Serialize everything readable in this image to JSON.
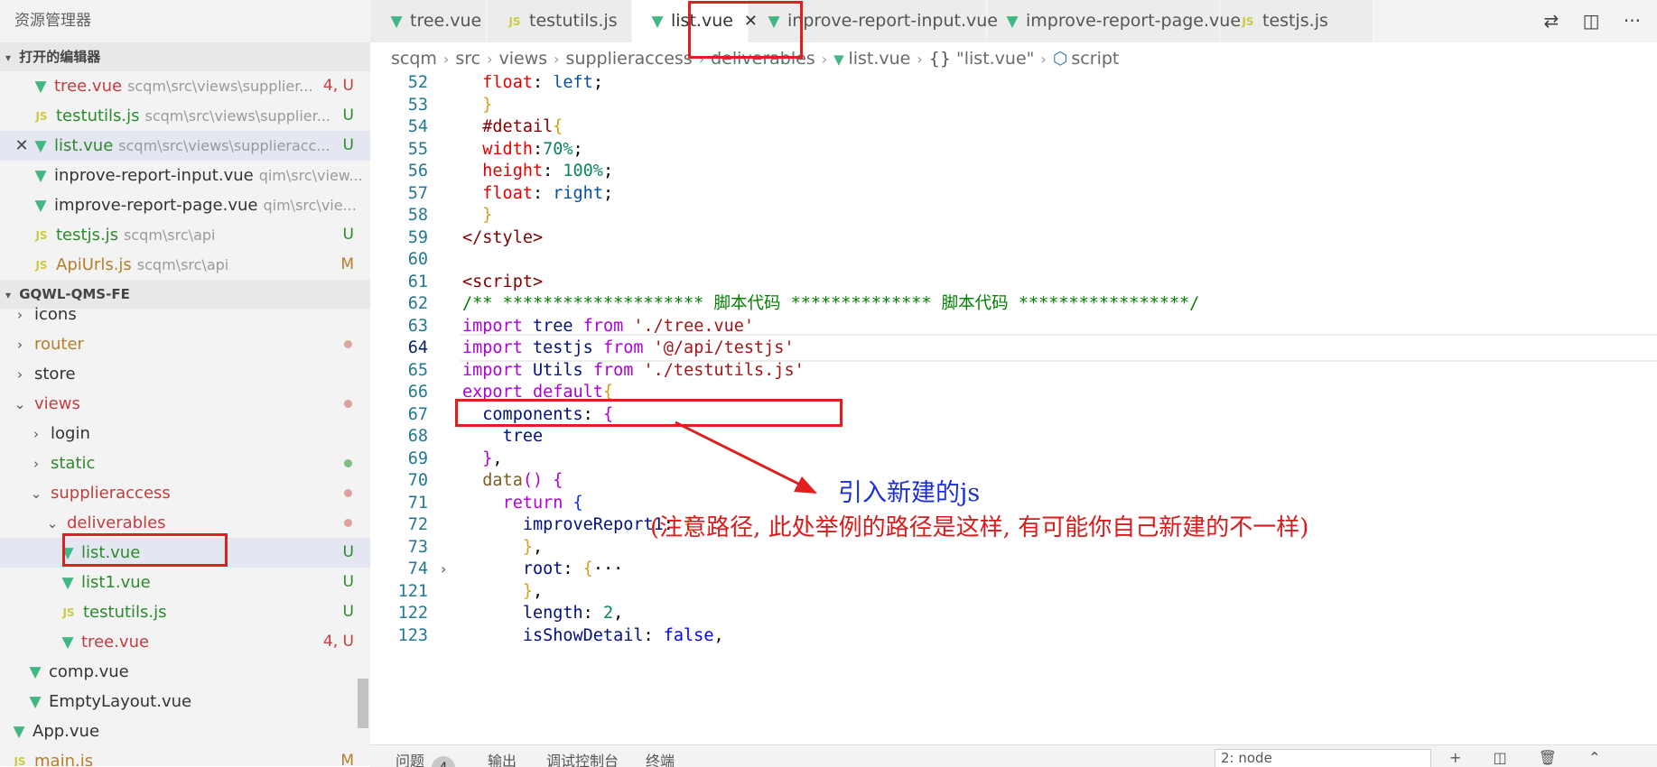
{
  "sidebar": {
    "title": "资源管理器",
    "open_editors": {
      "header": "打开的编辑器",
      "items": [
        {
          "name": "tree.vue",
          "path": "scqm\\src\\views\\supplier...",
          "status": "4, U",
          "type": "vue",
          "color": "err"
        },
        {
          "name": "testutils.js",
          "path": "scqm\\src\\views\\supplier...",
          "status": "U",
          "type": "js",
          "color": "unt"
        },
        {
          "name": "list.vue",
          "path": "scqm\\src\\views\\supplieracc...",
          "status": "U",
          "type": "vue",
          "color": "unt",
          "active": true
        },
        {
          "name": "inprove-report-input.vue",
          "path": "qim\\src\\view...",
          "status": "",
          "type": "vue",
          "color": "dflt"
        },
        {
          "name": "improve-report-page.vue",
          "path": "qim\\src\\vie...",
          "status": "",
          "type": "vue",
          "color": "dflt"
        },
        {
          "name": "testjs.js",
          "path": "scqm\\src\\api",
          "status": "U",
          "type": "js",
          "color": "unt"
        },
        {
          "name": "ApiUrls.js",
          "path": "scqm\\src\\api",
          "status": "M",
          "type": "js",
          "color": "mod"
        }
      ]
    },
    "project": {
      "header": "GQWL-QMS-FE",
      "tree": [
        {
          "label": "icons",
          "indent": 1,
          "kind": "folder-closed",
          "color": "dflt",
          "dot": ""
        },
        {
          "label": "router",
          "indent": 1,
          "kind": "folder-closed",
          "color": "mod",
          "dot": "#d9a7a0"
        },
        {
          "label": "store",
          "indent": 1,
          "kind": "folder-closed",
          "color": "dflt",
          "dot": ""
        },
        {
          "label": "views",
          "indent": 1,
          "kind": "folder-open",
          "color": "err",
          "dot": "#e0a0a0"
        },
        {
          "label": "login",
          "indent": 2,
          "kind": "folder-closed",
          "color": "dflt",
          "dot": ""
        },
        {
          "label": "static",
          "indent": 2,
          "kind": "folder-closed",
          "color": "unt",
          "dot": "#7fbf7f"
        },
        {
          "label": "supplieraccess",
          "indent": 2,
          "kind": "folder-open",
          "color": "err",
          "dot": "#e0a0a0"
        },
        {
          "label": "deliverables",
          "indent": 3,
          "kind": "folder-open",
          "color": "err",
          "dot": "#e0a0a0"
        },
        {
          "label": "list.vue",
          "indent": 4,
          "kind": "vue",
          "color": "unt",
          "status": "U",
          "selected": true
        },
        {
          "label": "list1.vue",
          "indent": 4,
          "kind": "vue",
          "color": "unt",
          "status": "U"
        },
        {
          "label": "testutils.js",
          "indent": 4,
          "kind": "js",
          "color": "unt",
          "status": "U"
        },
        {
          "label": "tree.vue",
          "indent": 4,
          "kind": "vue",
          "color": "err",
          "status": "4, U"
        },
        {
          "label": "comp.vue",
          "indent": 2,
          "kind": "vue",
          "color": "dflt",
          "status": ""
        },
        {
          "label": "EmptyLayout.vue",
          "indent": 2,
          "kind": "vue",
          "color": "dflt",
          "status": ""
        },
        {
          "label": "App.vue",
          "indent": 1,
          "kind": "vue",
          "color": "dflt",
          "status": ""
        },
        {
          "label": "main.js",
          "indent": 1,
          "kind": "js",
          "color": "mod",
          "status": "M"
        }
      ]
    }
  },
  "tabs": [
    {
      "label": "tree.vue",
      "type": "vue",
      "color": "err"
    },
    {
      "label": "testutils.js",
      "type": "js",
      "color": "unt"
    },
    {
      "label": "list.vue",
      "type": "vue",
      "color": "unt",
      "active": true
    },
    {
      "label": "inprove-report-input.vue",
      "type": "vue",
      "color": "dflt"
    },
    {
      "label": "improve-report-page.vue",
      "type": "vue",
      "color": "dflt"
    },
    {
      "label": "testjs.js",
      "type": "js",
      "color": "unt"
    }
  ],
  "breadcrumb": {
    "segments": [
      "scqm",
      "src",
      "views",
      "supplieraccess",
      "deliverables"
    ],
    "file": "list.vue",
    "object": "\"list.vue\"",
    "symbol": "script"
  },
  "editor": {
    "current_line": "64",
    "lines": [
      {
        "n": "52",
        "indent": 1,
        "tokens": [
          [
            "float",
            "prop"
          ],
          [
            ": ",
            "pl"
          ],
          [
            "left",
            "val"
          ],
          [
            ";",
            "pl"
          ]
        ]
      },
      {
        "n": "53",
        "indent": 0,
        "tokens": [
          [
            "  }",
            "br"
          ]
        ]
      },
      {
        "n": "54",
        "indent": 0,
        "tokens": [
          [
            "  #detail",
            "sel"
          ],
          [
            "{",
            "br"
          ]
        ]
      },
      {
        "n": "55",
        "indent": 1,
        "tokens": [
          [
            "width",
            "prop"
          ],
          [
            ":",
            "pl"
          ],
          [
            "70%",
            "num"
          ],
          [
            ";",
            "pl"
          ]
        ]
      },
      {
        "n": "56",
        "indent": 1,
        "tokens": [
          [
            "height",
            "prop"
          ],
          [
            ": ",
            "pl"
          ],
          [
            "100%",
            "num"
          ],
          [
            ";",
            "pl"
          ]
        ]
      },
      {
        "n": "57",
        "indent": 1,
        "tokens": [
          [
            "float",
            "prop"
          ],
          [
            ": ",
            "pl"
          ],
          [
            "right",
            "val"
          ],
          [
            ";",
            "pl"
          ]
        ]
      },
      {
        "n": "58",
        "indent": 0,
        "tokens": [
          [
            "  }",
            "br"
          ]
        ]
      },
      {
        "n": "59",
        "indent": 0,
        "tokens": [
          [
            "</style>",
            "tag"
          ]
        ]
      },
      {
        "n": "60",
        "indent": 0,
        "tokens": []
      },
      {
        "n": "61",
        "indent": 0,
        "tokens": [
          [
            "<script>",
            "tag"
          ]
        ]
      },
      {
        "n": "62",
        "indent": 0,
        "tokens": [
          [
            "/** ******************** 脚本代码 ************** 脚本代码 *****************/",
            "cmt"
          ]
        ]
      },
      {
        "n": "63",
        "indent": 0,
        "tokens": [
          [
            "import",
            "kw"
          ],
          [
            " ",
            "pl"
          ],
          [
            "tree",
            "id"
          ],
          [
            " ",
            "pl"
          ],
          [
            "from",
            "kw"
          ],
          [
            " ",
            "pl"
          ],
          [
            "'./tree.vue'",
            "str"
          ]
        ]
      },
      {
        "n": "64",
        "indent": 0,
        "tokens": [
          [
            "import",
            "kw"
          ],
          [
            " ",
            "pl"
          ],
          [
            "testjs",
            "id"
          ],
          [
            " ",
            "pl"
          ],
          [
            "from",
            "kw"
          ],
          [
            " ",
            "pl"
          ],
          [
            "'@/api/testjs'",
            "str"
          ]
        ]
      },
      {
        "n": "65",
        "indent": 0,
        "tokens": [
          [
            "import",
            "kw"
          ],
          [
            " ",
            "pl"
          ],
          [
            "Utils",
            "id"
          ],
          [
            " ",
            "pl"
          ],
          [
            "from",
            "kw"
          ],
          [
            " ",
            "pl"
          ],
          [
            "'./testutils.js'",
            "str"
          ]
        ]
      },
      {
        "n": "66",
        "indent": 0,
        "tokens": [
          [
            "export",
            "kw"
          ],
          [
            " ",
            "pl"
          ],
          [
            "default",
            "kw"
          ],
          [
            "{",
            "br"
          ]
        ]
      },
      {
        "n": "67",
        "indent": 1,
        "tokens": [
          [
            "components",
            "id"
          ],
          [
            ": ",
            "pl"
          ],
          [
            "{",
            "br2"
          ]
        ]
      },
      {
        "n": "68",
        "indent": 2,
        "tokens": [
          [
            "tree",
            "id"
          ]
        ]
      },
      {
        "n": "69",
        "indent": 1,
        "tokens": [
          [
            "}",
            "br2"
          ],
          [
            ",",
            "pl"
          ]
        ]
      },
      {
        "n": "70",
        "indent": 1,
        "tokens": [
          [
            "data",
            "fn"
          ],
          [
            "()",
            "br2"
          ],
          [
            " ",
            "pl"
          ],
          [
            "{",
            "br2"
          ]
        ]
      },
      {
        "n": "71",
        "indent": 2,
        "tokens": [
          [
            "return",
            "kw"
          ],
          [
            " ",
            "pl"
          ],
          [
            "{",
            "br3"
          ]
        ]
      },
      {
        "n": "72",
        "indent": 3,
        "tokens": [
          [
            "improveReport1",
            "id"
          ],
          [
            ": ",
            "pl"
          ],
          [
            "{",
            "br"
          ]
        ]
      },
      {
        "n": "73",
        "indent": 3,
        "tokens": [
          [
            "}",
            "br"
          ],
          [
            ",",
            "pl"
          ]
        ]
      },
      {
        "n": "74",
        "indent": 3,
        "fold": true,
        "tokens": [
          [
            "root",
            "id"
          ],
          [
            ": ",
            "pl"
          ],
          [
            "{",
            "br"
          ],
          [
            "···",
            "pl"
          ]
        ]
      },
      {
        "n": "121",
        "indent": 3,
        "tokens": [
          [
            "}",
            "br"
          ],
          [
            ",",
            "pl"
          ]
        ]
      },
      {
        "n": "122",
        "indent": 3,
        "tokens": [
          [
            "length",
            "id"
          ],
          [
            ": ",
            "pl"
          ],
          [
            "2",
            "num"
          ],
          [
            ",",
            "pl"
          ]
        ]
      },
      {
        "n": "123",
        "indent": 3,
        "tokens": [
          [
            "isShowDetail",
            "id"
          ],
          [
            ": ",
            "pl"
          ],
          [
            "false",
            "kw2"
          ],
          [
            ",",
            "pl"
          ]
        ]
      }
    ]
  },
  "annotations": {
    "note1": "引入新建的js",
    "note2": "(注意路径, 此处举例的路径是这样, 有可能你自己新建的不一样)"
  },
  "panel": {
    "tabs": [
      "问题",
      "输出",
      "调试控制台",
      "终端"
    ],
    "problems_count": "4",
    "select_value": "2: node"
  },
  "colors": {
    "annotation_red": "#e02020",
    "annotation_blue": "#1a2fd6",
    "vue_green": "#41b883",
    "js_yellow": "#cbcb41"
  }
}
